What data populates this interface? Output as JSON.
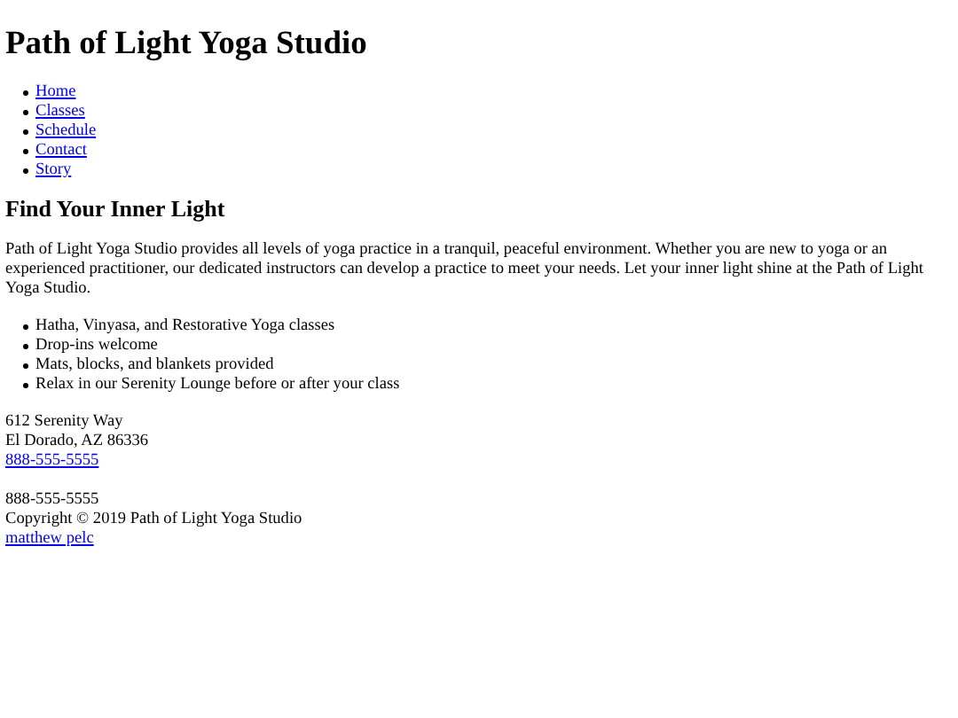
{
  "header": {
    "title": "Path of Light Yoga Studio"
  },
  "nav": [
    {
      "label": "Home"
    },
    {
      "label": "Classes"
    },
    {
      "label": "Schedule"
    },
    {
      "label": "Contact"
    },
    {
      "label": "Story"
    }
  ],
  "main": {
    "heading": "Find Your Inner Light",
    "paragraph": "Path of Light Yoga Studio provides all levels of yoga practice in a tranquil, peaceful environment. Whether you are new to yoga or an experienced practitioner, our dedicated instructors can develop a practice to meet your needs. Let your inner light shine at the Path of Light Yoga Studio.",
    "features": [
      "Hatha, Vinyasa, and Restorative Yoga classes",
      "Drop-ins welcome",
      "Mats, blocks, and blankets provided",
      "Relax in our Serenity Lounge before or after your class"
    ]
  },
  "address": {
    "street": "612 Serenity Way",
    "city": "El Dorado, AZ 86336",
    "phone_link": "888-555-5555"
  },
  "footer": {
    "phone": "888-555-5555",
    "copyright": "Copyright © 2019 Path of Light Yoga Studio",
    "author_link": "matthew pelc"
  }
}
